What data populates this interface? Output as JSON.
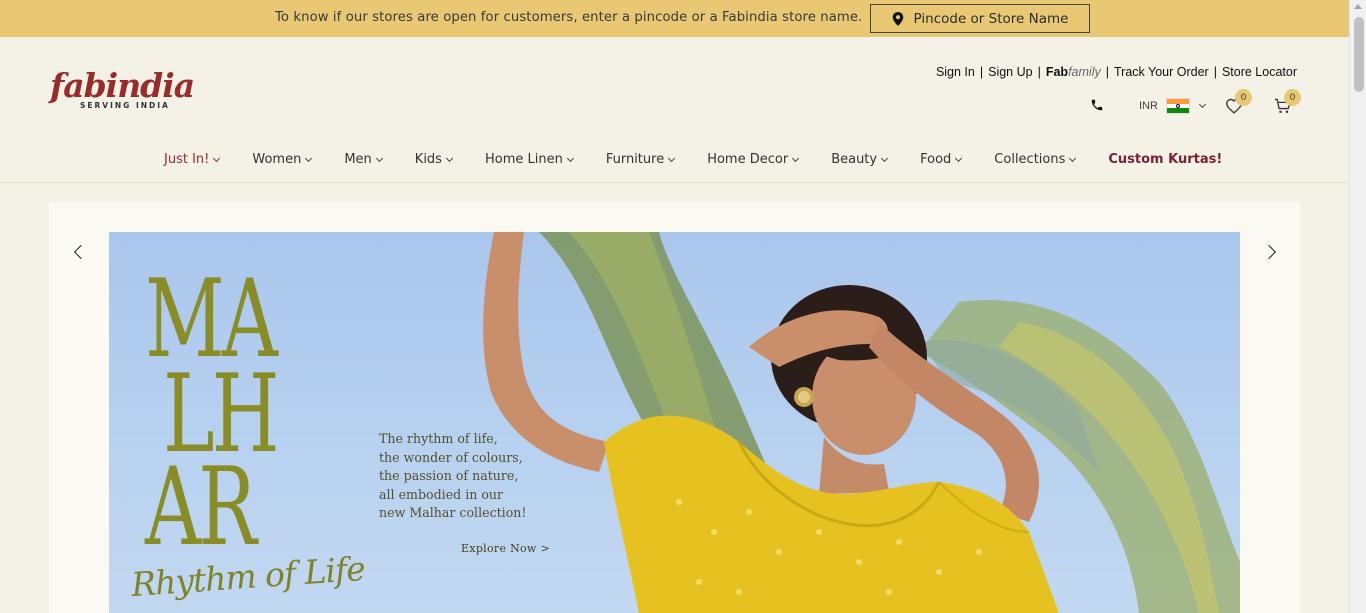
{
  "announcement": {
    "text": "To know if our stores are open for customers, enter a pincode or a Fabindia store name.",
    "button_label": "Pincode or Store Name"
  },
  "logo": {
    "wordmark": "fabindia",
    "tagline": "SERVING INDIA"
  },
  "account_links": {
    "sign_in": "Sign In",
    "sign_up": "Sign Up",
    "fab": "Fab",
    "family": "family",
    "track_order": "Track Your Order",
    "store_locator": "Store Locator"
  },
  "utility": {
    "currency": "INR",
    "wishlist_count": "0",
    "cart_count": "0"
  },
  "nav": {
    "items": [
      {
        "label": "Just In!"
      },
      {
        "label": "Women"
      },
      {
        "label": "Men"
      },
      {
        "label": "Kids"
      },
      {
        "label": "Home Linen"
      },
      {
        "label": "Furniture"
      },
      {
        "label": "Home Decor"
      },
      {
        "label": "Beauty"
      },
      {
        "label": "Food"
      },
      {
        "label": "Collections"
      }
    ],
    "highlight": "Custom Kurtas!"
  },
  "banner": {
    "title_line1": "MA",
    "title_line2": "LH",
    "title_line3": "AR",
    "script_text": "Rhythm of Life",
    "copy_lines": [
      "The rhythm of life,",
      "the wonder of colours,",
      "the passion of nature,",
      "all embodied in our",
      "new Malhar collection!"
    ],
    "cta": "Explore Now  >"
  },
  "colors": {
    "announcement_bg": "#e8c873",
    "page_bg": "#f4f1e6",
    "brand_red": "#9b2a2a",
    "custom_kurtas": "#7a2231",
    "malhar_olive": "#8a8d26",
    "sky_blue": "#b7d1f0"
  }
}
